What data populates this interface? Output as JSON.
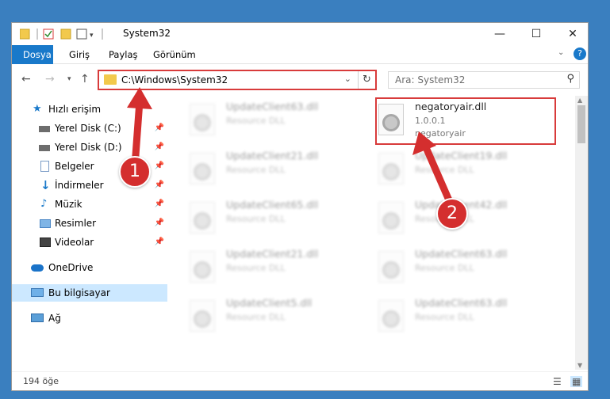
{
  "window": {
    "title": "System32"
  },
  "controls": {
    "minimize": "—",
    "maximize": "☐",
    "close": "✕"
  },
  "ribbon": {
    "tabs": [
      {
        "label": "Dosya",
        "active": true
      },
      {
        "label": "Giriş"
      },
      {
        "label": "Paylaş"
      },
      {
        "label": "Görünüm"
      }
    ]
  },
  "address": {
    "path": "C:\\Windows\\System32"
  },
  "search": {
    "placeholder": "Ara: System32"
  },
  "sidebar": {
    "items": [
      {
        "label": "Hızlı erişim",
        "icon": "star-icon"
      },
      {
        "label": "Yerel Disk (C:)",
        "icon": "drive-icon",
        "pinned": true
      },
      {
        "label": "Yerel Disk (D:)",
        "icon": "drive-icon",
        "pinned": true
      },
      {
        "label": "Belgeler",
        "icon": "documents-icon",
        "pinned": true
      },
      {
        "label": "İndirmeler",
        "icon": "download-icon",
        "pinned": true
      },
      {
        "label": "Müzik",
        "icon": "music-icon",
        "pinned": true
      },
      {
        "label": "Resimler",
        "icon": "pictures-icon",
        "pinned": true
      },
      {
        "label": "Videolar",
        "icon": "videos-icon",
        "pinned": true
      },
      {
        "label": "OneDrive",
        "icon": "cloud-icon"
      },
      {
        "label": "Bu bilgisayar",
        "icon": "computer-icon",
        "selected": true
      },
      {
        "label": "Ağ",
        "icon": "network-icon"
      }
    ]
  },
  "files": {
    "left": [
      {
        "name": "UpdateClient63.dll",
        "type": "Resource DLL"
      },
      {
        "name": "UpdateClient21.dll",
        "type": "Resource DLL"
      },
      {
        "name": "UpdateClient65.dll",
        "type": "Resource DLL"
      },
      {
        "name": "UpdateClient21.dll",
        "type": "Resource DLL"
      },
      {
        "name": "UpdateClient5.dll",
        "type": "Resource DLL"
      }
    ],
    "right": [
      {
        "name": "UpdateClient19.dll",
        "type": "Resource DLL"
      },
      {
        "name": "UpdateClient42.dll",
        "type": "Resource DLL"
      },
      {
        "name": "UpdateClient63.dll",
        "type": "Resource DLL"
      },
      {
        "name": "UpdateClient63.dll",
        "type": "Resource DLL"
      }
    ],
    "highlighted": {
      "name": "negatoryair.dll",
      "version": "1.0.0.1",
      "description": "negatoryair"
    }
  },
  "status": {
    "count": "194 öğe"
  },
  "annotations": {
    "one": "1",
    "two": "2"
  },
  "colors": {
    "accent": "#1979ca",
    "annotation": "#d42e2e"
  }
}
